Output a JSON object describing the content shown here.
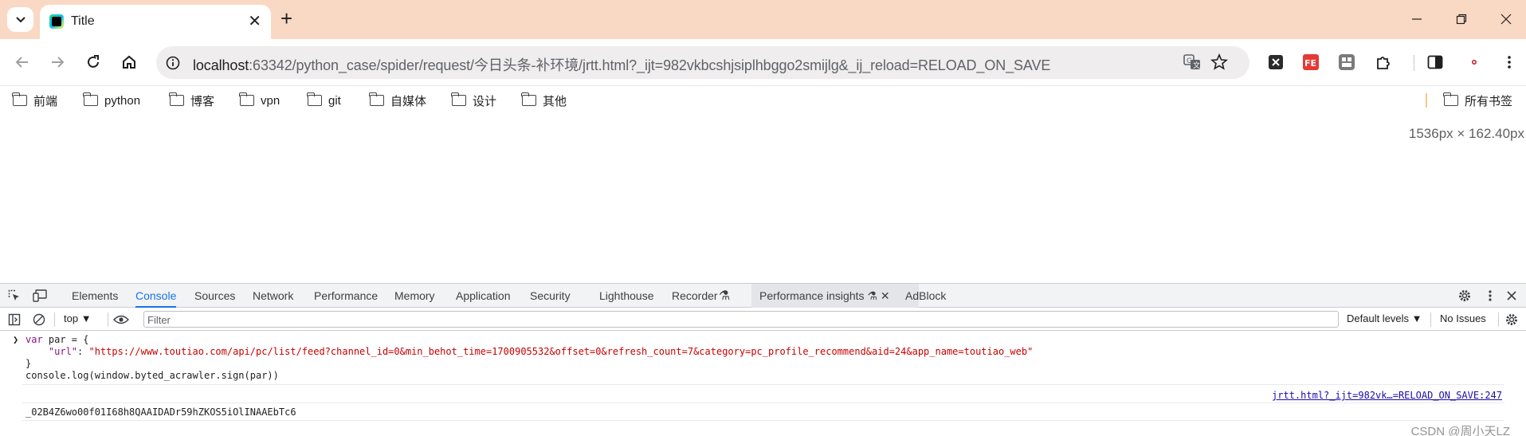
{
  "browser": {
    "tab": {
      "title": "Title"
    },
    "url": {
      "host": "localhost",
      "rest": ":63342/python_case/spider/request/今日头条-补环境/jrtt.html?_ijt=982vkbcshjsiplhbggo2smijlg&_ij_reload=RELOAD_ON_SAVE"
    },
    "bookmarks": [
      "前端",
      "python",
      "博客",
      "vpn",
      "git",
      "自媒体",
      "设计",
      "其他"
    ],
    "all_bookmarks": "所有书签"
  },
  "page": {
    "dimensions": "1536px × 162.40px"
  },
  "devtools": {
    "tabs": [
      "Elements",
      "Console",
      "Sources",
      "Network",
      "Performance",
      "Memory",
      "Application",
      "Security",
      "Lighthouse",
      "Recorder",
      "Performance insights",
      "AdBlock"
    ],
    "active_tab": "Console",
    "context": "top",
    "filter_placeholder": "Filter",
    "levels": "Default levels",
    "issues": "No Issues",
    "console": {
      "line1_kw": "var",
      "line1_rest": " par = {",
      "line2_key": "\"url\"",
      "line2_colon": ": ",
      "line2_value": "\"https://www.toutiao.com/api/pc/list/feed?channel_id=0&min_behot_time=1700905532&offset=0&refresh_count=7&category=pc_profile_recommend&aid=24&app_name=toutiao_web\"",
      "line3": "}",
      "line4": "console.log(window.byted_acrawler.sign(par))",
      "source_link": "jrtt.html?_ijt=982vk…=RELOAD_ON_SAVE:247",
      "output": "_02B4Z6wo00f01I68h8QAAIDADr59hZKOS5iOlINAAEbTc6"
    }
  },
  "watermark": "CSDN @周小天LZ"
}
